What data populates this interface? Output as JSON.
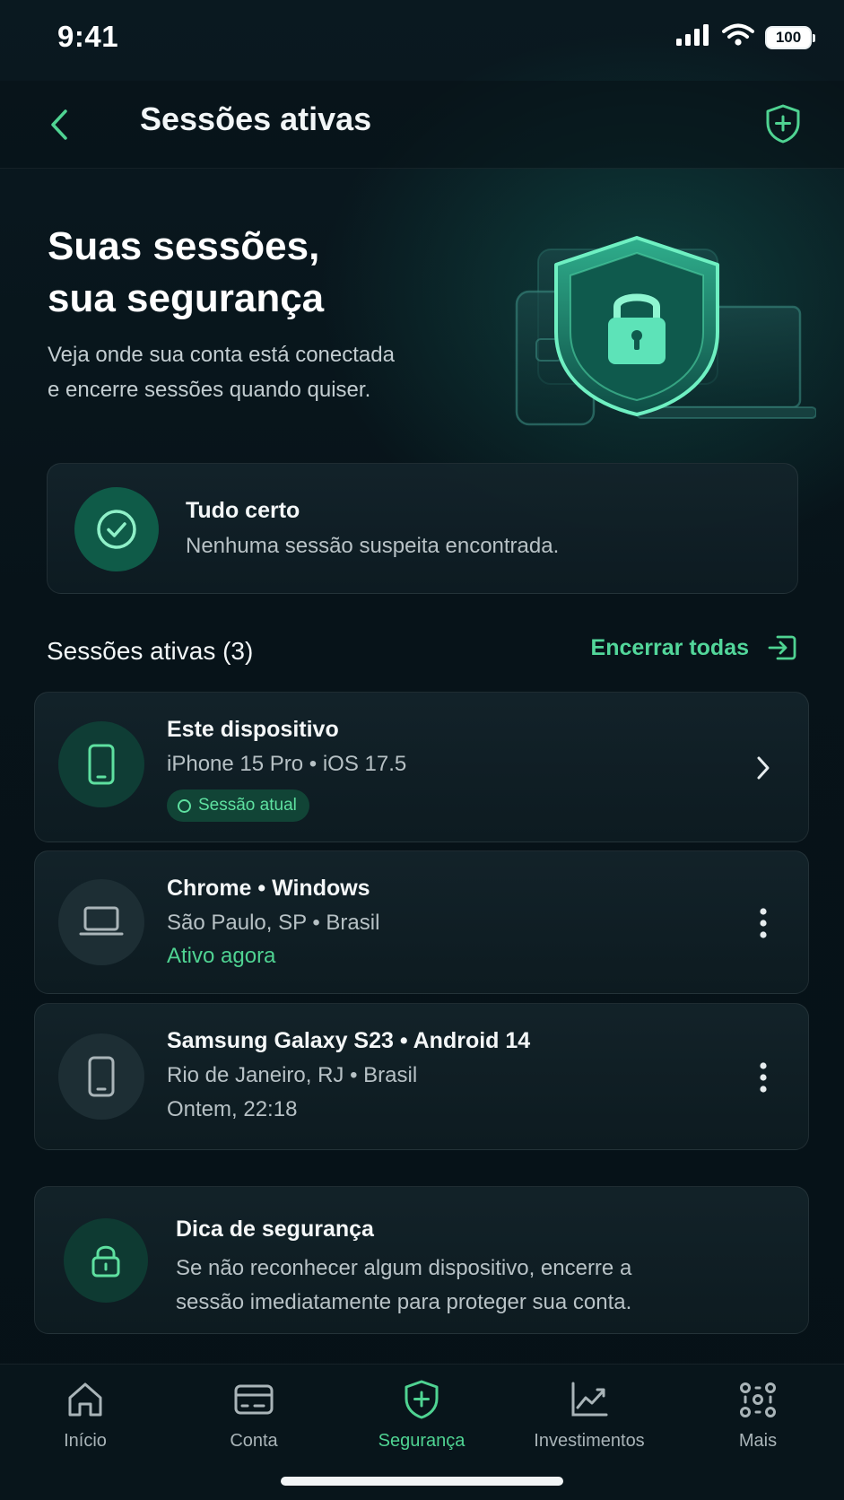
{
  "status_bar": {
    "time": "9:41",
    "battery": "100"
  },
  "header": {
    "title": "Sessões ativas"
  },
  "hero": {
    "title_line1": "Suas sessões,",
    "title_line2": "sua segurança",
    "subtitle_line1": "Veja onde sua conta está conectada",
    "subtitle_line2": "e encerre sessões quando quiser."
  },
  "status_card": {
    "title": "Tudo certo",
    "text": "Nenhuma sessão suspeita encontrada."
  },
  "sessions_section": {
    "title": "Sessões ativas (3)",
    "end_all_label": "Encerrar todas"
  },
  "sessions": [
    {
      "title": "Este dispositivo",
      "line1": "iPhone 15 Pro • iOS 17.5",
      "badge": "Sessão atual",
      "icon": "phone-icon",
      "action": "chevron-right-icon"
    },
    {
      "title": "Chrome • Windows",
      "line1": "São Paulo, SP • Brasil",
      "line2": "Ativo agora",
      "icon": "laptop-icon",
      "action": "more-vertical-icon"
    },
    {
      "title": "Samsung Galaxy S23 • Android 14",
      "line1": "Rio de Janeiro, RJ • Brasil",
      "line2": "Ontem, 22:18",
      "icon": "phone-icon",
      "action": "more-vertical-icon"
    }
  ],
  "tip": {
    "title": "Dica de segurança",
    "line1": "Se não reconhecer algum dispositivo, encerre a",
    "line2": "sessão imediatamente para proteger sua conta."
  },
  "bottom_nav": {
    "items": [
      {
        "label": "Início",
        "icon": "home-icon"
      },
      {
        "label": "Conta",
        "icon": "card-icon"
      },
      {
        "label": "Segurança",
        "icon": "shield-icon",
        "active": true
      },
      {
        "label": "Investimentos",
        "icon": "chart-icon"
      },
      {
        "label": "Mais",
        "icon": "grid-icon"
      }
    ]
  },
  "colors": {
    "accent": "#4fd392",
    "background": "#07141b",
    "card": "#12232a",
    "text_secondary": "#b7c1c5"
  }
}
